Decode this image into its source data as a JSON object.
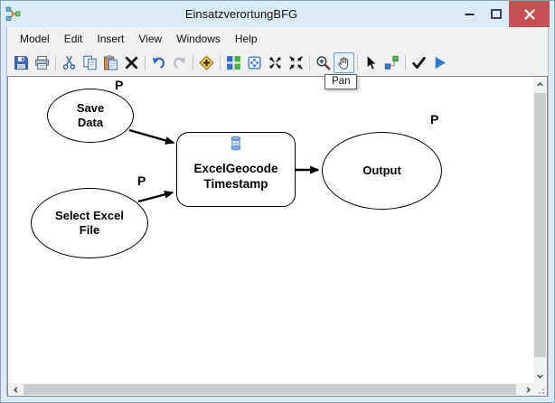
{
  "window": {
    "title": "EinsatzverortungBFG",
    "controls": [
      "minimize",
      "maximize",
      "close"
    ],
    "colors": {
      "frame": "#d9ecf5",
      "close_button": "#c75050",
      "chrome_bg": "#f0f0f0"
    }
  },
  "menu": {
    "items": [
      "Model",
      "Edit",
      "Insert",
      "View",
      "Windows",
      "Help"
    ]
  },
  "toolbar": {
    "buttons": [
      {
        "name": "save"
      },
      {
        "name": "print"
      },
      {
        "name": "cut"
      },
      {
        "name": "copy"
      },
      {
        "name": "paste"
      },
      {
        "name": "delete"
      },
      {
        "name": "undo"
      },
      {
        "name": "redo",
        "disabled": true
      },
      {
        "name": "add-data-or-tool"
      },
      {
        "name": "auto-layout"
      },
      {
        "name": "full-extent"
      },
      {
        "name": "fixed-zoom-in"
      },
      {
        "name": "fixed-zoom-out"
      },
      {
        "name": "zoom-in"
      },
      {
        "name": "pan",
        "active": true
      },
      {
        "name": "select"
      },
      {
        "name": "connect"
      },
      {
        "name": "validate"
      },
      {
        "name": "run"
      }
    ],
    "tooltip": {
      "text": "Pan"
    },
    "highlight_border": "#66a1d4"
  },
  "canvas": {
    "nodes": [
      {
        "id": "save-data",
        "type": "input-variable",
        "shape": "ellipse",
        "label": "Save Data",
        "parameter": "P"
      },
      {
        "id": "select-excel-file",
        "type": "input-variable",
        "shape": "ellipse",
        "label": "Select Excel File",
        "parameter": "P"
      },
      {
        "id": "excel-geocode-timestamp",
        "type": "script-tool",
        "shape": "rounded-rect",
        "label": "ExcelGeocodeTimestamp"
      },
      {
        "id": "output",
        "type": "derived-variable",
        "shape": "ellipse",
        "label": "Output",
        "parameter": "P"
      }
    ],
    "edges": [
      {
        "from": "save-data",
        "to": "excel-geocode-timestamp"
      },
      {
        "from": "select-excel-file",
        "to": "excel-geocode-timestamp"
      },
      {
        "from": "excel-geocode-timestamp",
        "to": "output"
      }
    ],
    "node_fill": "#ffffff",
    "node_stroke": "#000000"
  }
}
